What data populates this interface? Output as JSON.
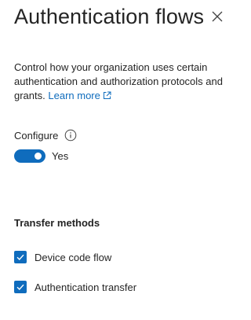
{
  "header": {
    "title": "Authentication flows",
    "close_icon": "close-icon"
  },
  "description": {
    "text": "Control how your organization uses certain authentication and authorization protocols and grants.",
    "link_label": "Learn more",
    "link_icon": "external-link-icon"
  },
  "configure": {
    "label": "Configure",
    "info_icon": "info-icon",
    "toggle_on": true,
    "toggle_state": "Yes"
  },
  "transfer_methods": {
    "title": "Transfer methods",
    "items": [
      {
        "label": "Device code flow",
        "checked": true
      },
      {
        "label": "Authentication transfer",
        "checked": true
      }
    ]
  },
  "colors": {
    "accent": "#0f6cbd",
    "text": "#242424",
    "background": "#ffffff"
  }
}
